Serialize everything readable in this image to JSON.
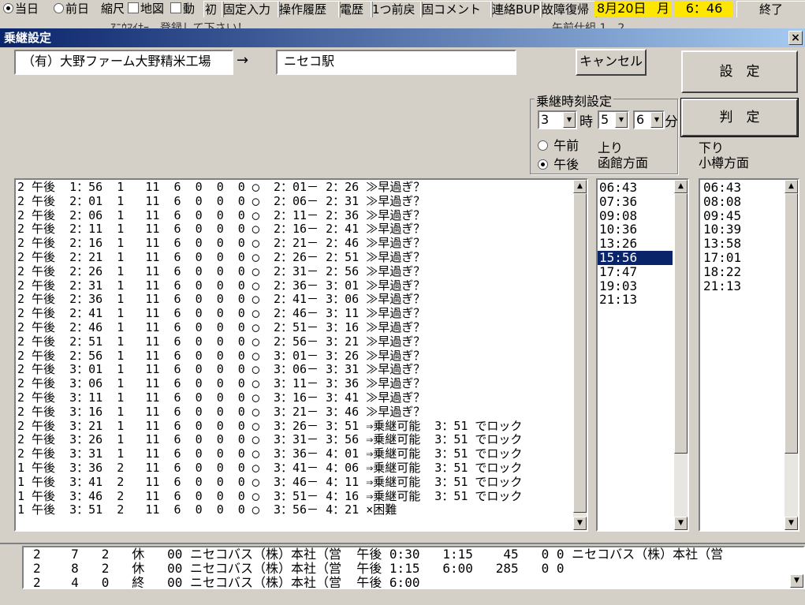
{
  "toolbar": {
    "radio_today": "当日",
    "radio_prev": "前日",
    "shrink": "縮尺",
    "map": "地図",
    "move": "動",
    "init": "初",
    "fixed_input": "固定入力",
    "op_history": "操作履歴",
    "call_history": "電歴",
    "undo": "1つ前戻",
    "comment": "固コメント",
    "contact_bup": "連絡BUP",
    "fault_recovery": "故障復帰",
    "date": "8月20日",
    "weekday": "月",
    "time": "6：46",
    "exit": "終了"
  },
  "underbar": {
    "left_text": "ｱﾆｳﾏｲﾅｰ　登録して下さい！",
    "right_text": "午前仕組 1　2"
  },
  "dialog": {
    "title": "乗継設定",
    "close": "×",
    "from_field": "（有）大野ファーム大野精米工場",
    "arrow": "→",
    "to_field": "ニセコ駅",
    "cancel_button": "キャンセル",
    "set_button": "設　定",
    "judge_button": "判　定",
    "group_label": "乗継時刻設定",
    "hour_value": "3",
    "hour_unit": "時",
    "min_tens_value": "5",
    "min_ones_value": "6",
    "min_unit": "分",
    "am_label": "午前",
    "pm_label": "午後",
    "up_label": "上り",
    "up_dir": "函館方面",
    "down_label": "下り",
    "down_dir": "小樽方面"
  },
  "main_list": [
    "2 午後  1：56  1   11  6  0  0  0 ◯  2：01－ 2：26 ≫早過ぎ？",
    "2 午後  2：01  1   11  6  0  0  0 ◯  2：06－ 2：31 ≫早過ぎ？",
    "2 午後  2：06  1   11  6  0  0  0 ◯  2：11－ 2：36 ≫早過ぎ？",
    "2 午後  2：11  1   11  6  0  0  0 ◯  2：16－ 2：41 ≫早過ぎ？",
    "2 午後  2：16  1   11  6  0  0  0 ◯  2：21－ 2：46 ≫早過ぎ？",
    "2 午後  2：21  1   11  6  0  0  0 ◯  2：26－ 2：51 ≫早過ぎ？",
    "2 午後  2：26  1   11  6  0  0  0 ◯  2：31－ 2：56 ≫早過ぎ？",
    "2 午後  2：31  1   11  6  0  0  0 ◯  2：36－ 3：01 ≫早過ぎ？",
    "2 午後  2：36  1   11  6  0  0  0 ◯  2：41－ 3：06 ≫早過ぎ？",
    "2 午後  2：41  1   11  6  0  0  0 ◯  2：46－ 3：11 ≫早過ぎ？",
    "2 午後  2：46  1   11  6  0  0  0 ◯  2：51－ 3：16 ≫早過ぎ？",
    "2 午後  2：51  1   11  6  0  0  0 ◯  2：56－ 3：21 ≫早過ぎ？",
    "2 午後  2：56  1   11  6  0  0  0 ◯  3：01－ 3：26 ≫早過ぎ？",
    "2 午後  3：01  1   11  6  0  0  0 ◯  3：06－ 3：31 ≫早過ぎ？",
    "2 午後  3：06  1   11  6  0  0  0 ◯  3：11－ 3：36 ≫早過ぎ？",
    "2 午後  3：11  1   11  6  0  0  0 ◯  3：16－ 3：41 ≫早過ぎ？",
    "2 午後  3：16  1   11  6  0  0  0 ◯  3：21－ 3：46 ≫早過ぎ？",
    "2 午後  3：21  1   11  6  0  0  0 ◯  3：26－ 3：51 ⇒乗継可能  3：51 でロック",
    "2 午後  3：26  1   11  6  0  0  0 ◯  3：31－ 3：56 ⇒乗継可能  3：51 でロック",
    "2 午後  3：31  1   11  6  0  0  0 ◯  3：36－ 4：01 ⇒乗継可能  3：51 でロック",
    "1 午後  3：36  2   11  6  0  0  0 ◯  3：41－ 4：06 ⇒乗継可能  3：51 でロック",
    "1 午後  3：41  2   11  6  0  0  0 ◯  3：46－ 4：11 ⇒乗継可能  3：51 でロック",
    "1 午後  3：46  2   11  6  0  0  0 ◯  3：51－ 4：16 ⇒乗継可能  3：51 でロック",
    "1 午後  3：51  2   11  6  0  0  0 ◯  3：56－ 4：21 ×困難"
  ],
  "up_list": [
    "06:43",
    "07:36",
    "09:08",
    "10:36",
    "13:26",
    "15:56",
    "17:47",
    "19:03",
    "21:13"
  ],
  "up_selected_index": 5,
  "down_list": [
    "06:43",
    "08:08",
    "09:45",
    "10:39",
    "13:58",
    "17:01",
    "18:22",
    "21:13"
  ],
  "bottom_list": [
    "2    7   2   休   00 ニセコバス（株）本社（営  午後 0:30   1:15    45   0 0 ニセコバス（株）本社（営",
    "2    8   2   休   00 ニセコバス（株）本社（営  午後 1:15   6:00   285   0 0",
    "2    4   0   終   00 ニセコバス（株）本社（営  午後 6:00"
  ],
  "colors": {
    "title_start": "#0a246a",
    "title_end": "#a6caf0",
    "date_bg": "#ffe600",
    "selection": "#0a246a"
  }
}
